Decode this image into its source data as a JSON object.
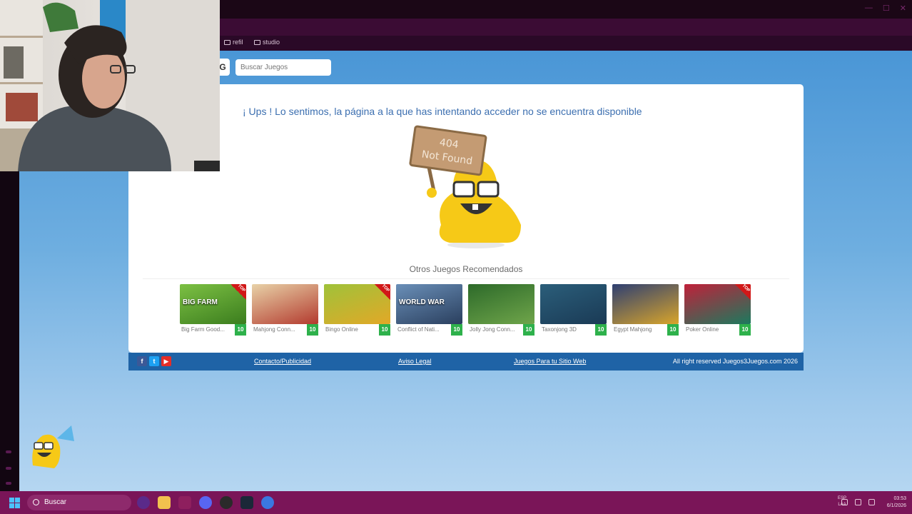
{
  "browser": {
    "bookmarks": [
      "refil",
      "studio"
    ]
  },
  "site": {
    "search_placeholder": "Buscar Juegos",
    "error_message": "¡ Ups ! Lo sentimos, la página a la que has intentando acceder no se encuentra disponible",
    "sign_text_line1": "404",
    "sign_text_line2": "Not Found",
    "recommended_title": "Otros Juegos Recomendados",
    "games": [
      {
        "name": "Big Farm Good...",
        "score": "10",
        "top": true,
        "thumb_label": "BIG FARM",
        "color1": "#7cc043",
        "color2": "#3b7d1e"
      },
      {
        "name": "Mahjong Conn...",
        "score": "10",
        "top": false,
        "thumb_label": "",
        "color1": "#e8d2a8",
        "color2": "#b33a2e"
      },
      {
        "name": "Bingo Online",
        "score": "10",
        "top": true,
        "thumb_label": "",
        "color1": "#9fc23a",
        "color2": "#e2a827"
      },
      {
        "name": "Conflict of Nati...",
        "score": "10",
        "top": false,
        "thumb_label": "WORLD WAR",
        "color1": "#6a8fb8",
        "color2": "#2a3f5e"
      },
      {
        "name": "Jolly Jong Conn...",
        "score": "10",
        "top": false,
        "thumb_label": "",
        "color1": "#2d6a2a",
        "color2": "#6fa54a"
      },
      {
        "name": "Taxonjong 3D",
        "score": "10",
        "top": false,
        "thumb_label": "",
        "color1": "#2b5e7a",
        "color2": "#1a3a55"
      },
      {
        "name": "Egypt Mahjong",
        "score": "10",
        "top": false,
        "thumb_label": "",
        "color1": "#2e3f72",
        "color2": "#d9a52a"
      },
      {
        "name": "Poker Online",
        "score": "10",
        "top": true,
        "thumb_label": "",
        "color1": "#c0213a",
        "color2": "#1b7a5e"
      }
    ],
    "footer": {
      "contact": "Contacto/Publicidad",
      "legal": "Aviso Legal",
      "for_site": "Juegos Para tu Sitio Web",
      "copyright": "All right reserved Juegos3Juegos.com 2026",
      "social": [
        "f",
        "t",
        "▶"
      ]
    }
  },
  "taskbar": {
    "search_label": "Buscar",
    "lang_line1": "ESP",
    "lang_line2": "LAA",
    "time": "03:53",
    "date": "6/1/2026"
  },
  "colors": {
    "accent_blue": "#1f63a6",
    "message_blue": "#3c6fb0",
    "score_green": "#2eb14b",
    "taskbar": "#7a1558"
  }
}
